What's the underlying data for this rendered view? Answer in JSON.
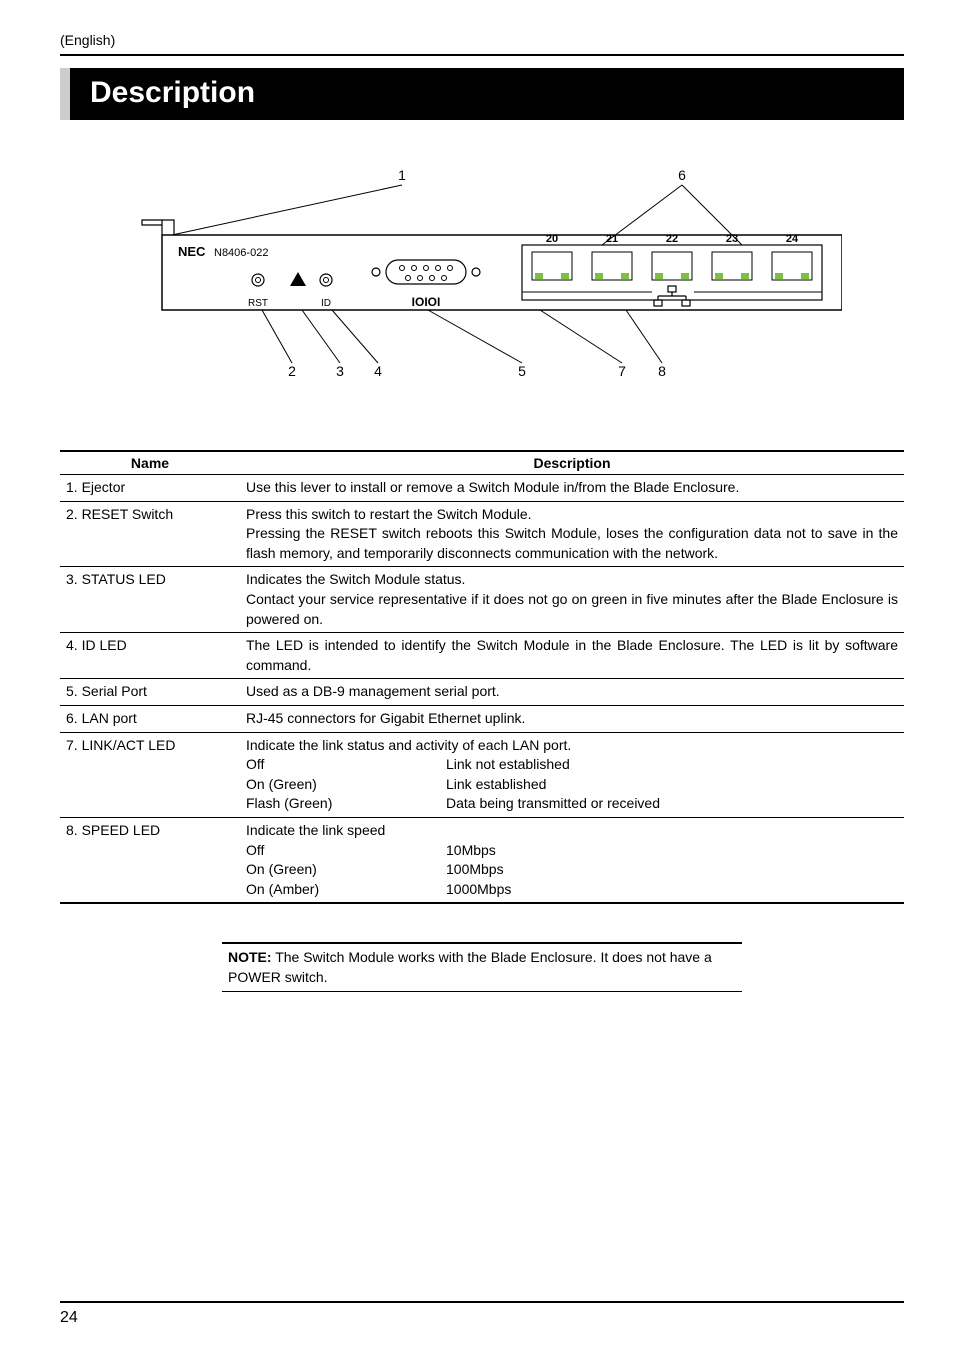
{
  "header_label": "(English)",
  "title": "Description",
  "diagram": {
    "brand": "NEC",
    "model": "N8406-022",
    "rst_label": "RST",
    "id_label": "ID",
    "alert_icon": "alert-triangle-icon",
    "serial_icon": "serial-icon",
    "port_labels": [
      "20",
      "21",
      "22",
      "23",
      "24"
    ],
    "callouts": [
      "1",
      "2",
      "3",
      "4",
      "5",
      "6",
      "7",
      "8"
    ]
  },
  "table": {
    "col_name": "Name",
    "col_desc": "Description",
    "rows": [
      {
        "name": "1. Ejector",
        "desc": "Use this lever to install or remove a Switch Module in/from the Blade Enclosure."
      },
      {
        "name": "2. RESET Switch",
        "desc_line1": "Press this switch to restart the Switch Module.",
        "desc_line2": "Pressing the RESET switch reboots this Switch Module, loses the configuration data not to save in the flash memory, and temporarily disconnects communication with the network."
      },
      {
        "name": "3. STATUS LED",
        "desc_line1": "Indicates the Switch Module status.",
        "desc_line2": "Contact your service representative if it does not go on green in five minutes after the Blade Enclosure is powered on."
      },
      {
        "name": "4. ID LED",
        "desc": "The LED is intended to identify the Switch Module in the Blade Enclosure. The LED is lit by software command."
      },
      {
        "name": "5. Serial Port",
        "desc": "Used as a DB-9 management serial port."
      },
      {
        "name": "6. LAN port",
        "desc": "RJ-45 connectors for Gigabit Ethernet uplink."
      },
      {
        "name": "7. LINK/ACT LED",
        "desc_line1": "Indicate the link status and activity of each LAN port.",
        "kv": [
          {
            "k": "Off",
            "v": "Link not established"
          },
          {
            "k": "On (Green)",
            "v": "Link established"
          },
          {
            "k": "Flash (Green)",
            "v": "Data being transmitted or received"
          }
        ]
      },
      {
        "name": "8. SPEED LED",
        "desc_line1": "Indicate the link speed",
        "kv": [
          {
            "k": "Off",
            "v": "10Mbps"
          },
          {
            "k": "On (Green)",
            "v": "100Mbps"
          },
          {
            "k": "On (Amber)",
            "v": "1000Mbps"
          }
        ]
      }
    ]
  },
  "note_label": "NOTE:",
  "note_text": " The Switch Module works with the Blade Enclosure. It does not have a POWER switch.",
  "page_number": "24"
}
